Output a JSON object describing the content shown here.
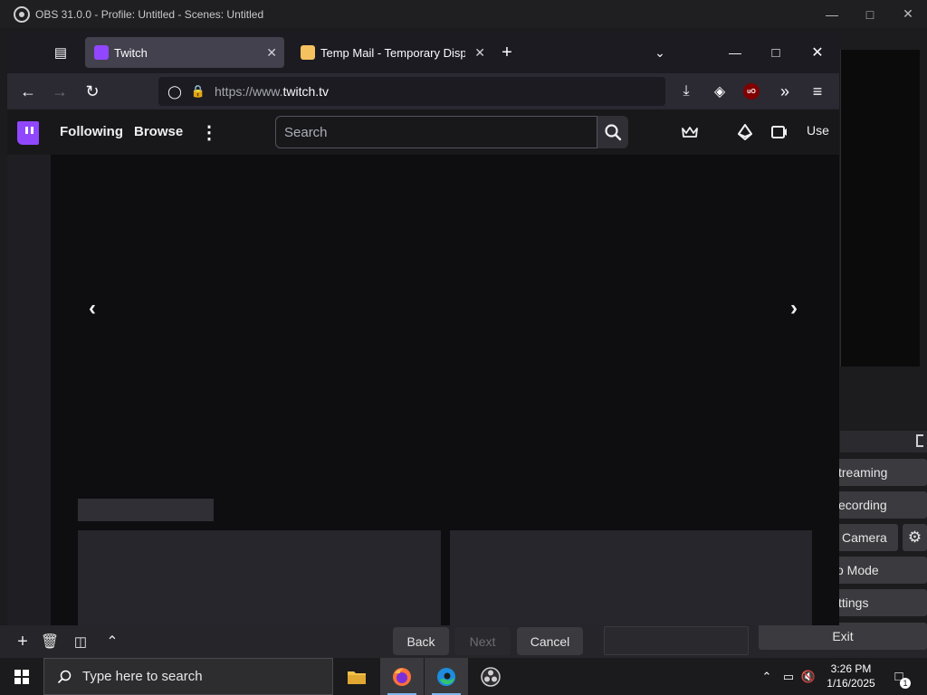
{
  "obs": {
    "title": "OBS 31.0.0 - Profile: Untitled - Scenes: Untitled",
    "controls": {
      "start_streaming": "treaming",
      "start_recording": "ecording",
      "virtual_camera": "Camera",
      "studio_mode": "o Mode",
      "settings": "ttings",
      "exit": "Exit"
    },
    "wizard": {
      "back": "Back",
      "next": "Next",
      "cancel": "Cancel"
    }
  },
  "browser": {
    "tabs": [
      {
        "label": "Twitch",
        "active": true
      },
      {
        "label": "Temp Mail - Temporary Disposa",
        "active": false
      }
    ],
    "url": {
      "scheme": "https://www.",
      "domain": "twitch.tv"
    }
  },
  "twitch": {
    "nav": {
      "following": "Following",
      "browse": "Browse",
      "search_placeholder": "Search",
      "user_partial": "Use"
    },
    "colors": {
      "brand": "#9147ff"
    }
  },
  "taskbar": {
    "search_placeholder": "Type here to search",
    "time": "3:26 PM",
    "date": "1/16/2025",
    "notification_count": "1"
  }
}
